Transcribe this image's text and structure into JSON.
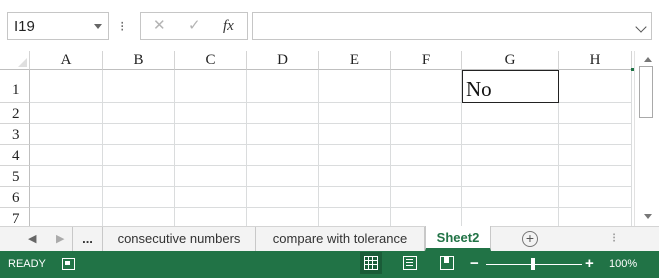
{
  "formula_bar": {
    "name_box_value": "I19",
    "menu_dots": "⁝",
    "cancel_icon": "✕",
    "enter_icon": "✓",
    "fx_label": "fx",
    "formula_value": ""
  },
  "columns": [
    "A",
    "B",
    "C",
    "D",
    "E",
    "F",
    "G",
    "H"
  ],
  "rows": [
    "1",
    "2",
    "3",
    "4",
    "5",
    "6",
    "7"
  ],
  "cells": {
    "G1": "No"
  },
  "sheet_tabs": {
    "nav_prev": "◀",
    "nav_next": "▶",
    "overflow": "...",
    "tabs": [
      "consecutive numbers",
      "compare with tolerance",
      "Sheet2"
    ],
    "active": "Sheet2",
    "add_symbol": "+",
    "more": "⁝"
  },
  "status_bar": {
    "ready": "READY",
    "zoom_minus": "−",
    "zoom_plus": "+",
    "zoom_percent": "100%",
    "zoom_level_percent": 100
  },
  "colors": {
    "accent": "#217346",
    "gridline": "#dadcdd"
  }
}
